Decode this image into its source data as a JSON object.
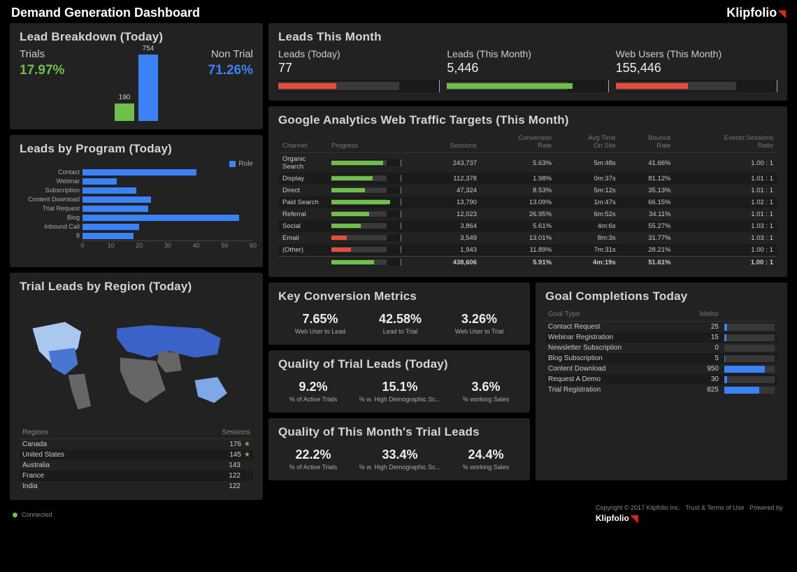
{
  "page": {
    "title": "Demand Generation Dashboard",
    "brand": "Klipfolio"
  },
  "lead_breakdown": {
    "title": "Lead Breakdown (Today)",
    "trials_label": "Trials",
    "trials_pct": "17.97%",
    "nontrial_label": "Non Trial",
    "nontrial_pct": "71.26%",
    "bar_trials": "190",
    "bar_nontrials": "754"
  },
  "leads_by_program": {
    "title": "Leads by Program (Today)",
    "legend": "Role",
    "axis_ticks": [
      "0",
      "10",
      "20",
      "30",
      "40",
      "50",
      "60"
    ]
  },
  "chart_data": [
    {
      "panel": "lead_breakdown",
      "type": "bar",
      "categories": [
        "Trials",
        "Non Trial"
      ],
      "values": [
        190,
        754
      ]
    },
    {
      "panel": "leads_by_program",
      "type": "bar",
      "orientation": "horizontal",
      "xlabel": "",
      "xlim": [
        0,
        60
      ],
      "series_name": "Role",
      "categories": [
        "Contact",
        "Webinar",
        "Subscription",
        "Content Download",
        "Trial Request",
        "Blog",
        "Inbound Call",
        "8"
      ],
      "values": [
        40,
        12,
        19,
        24,
        23,
        55,
        20,
        18
      ]
    },
    {
      "panel": "goal_completions",
      "type": "bar",
      "orientation": "horizontal",
      "categories": [
        "Contact Request",
        "Webinar Registration",
        "Newsletter Subscription",
        "Blog Subscription",
        "Content Download",
        "Request A Demo",
        "Trial Registration"
      ],
      "values": [
        25,
        15,
        0,
        5,
        950,
        30,
        825
      ]
    }
  ],
  "trial_leads_region": {
    "title": "Trial Leads by Region (Today)",
    "headers": {
      "region": "Regions",
      "sessions": "Sessions"
    },
    "rows": [
      {
        "region": "Canada",
        "sessions": "176",
        "star": true
      },
      {
        "region": "United States",
        "sessions": "145",
        "star": true
      },
      {
        "region": "Australia",
        "sessions": "143",
        "star": false
      },
      {
        "region": "France",
        "sessions": "122",
        "star": false
      },
      {
        "region": "India",
        "sessions": "122",
        "star": false
      }
    ]
  },
  "leads_month": {
    "title": "Leads This Month",
    "cards": [
      {
        "title": "Leads (Today)",
        "value": "77",
        "fill_pct": 36,
        "color": "red"
      },
      {
        "title": "Leads (This Month)",
        "value": "5,446",
        "fill_pct": 78,
        "color": "grn"
      },
      {
        "title": "Web Users (This Month)",
        "value": "155,446",
        "fill_pct": 45,
        "color": "red"
      }
    ]
  },
  "ga_targets": {
    "title": "Google Analytics Web Traffic Targets (This Month)",
    "headers": [
      "Channel",
      "Progress",
      "Sessions",
      "Conversion Rate",
      "Avg Time On Site",
      "Bounce Rate",
      "Events:Sessions Ratio"
    ],
    "rows": [
      {
        "channel": "Organic Search",
        "progress": 75,
        "color": "g",
        "sessions": "243,737",
        "conv": "5.63%",
        "time": "5m:48s",
        "bounce": "41.66%",
        "ratio": "1.00 : 1"
      },
      {
        "channel": "Display",
        "progress": 60,
        "color": "g",
        "sessions": "112,378",
        "conv": "1.98%",
        "time": "0m:37s",
        "bounce": "81.12%",
        "ratio": "1.01 : 1"
      },
      {
        "channel": "Direct",
        "progress": 48,
        "color": "g",
        "sessions": "47,324",
        "conv": "8.53%",
        "time": "5m:12s",
        "bounce": "35.13%",
        "ratio": "1.01 : 1"
      },
      {
        "channel": "Paid Search",
        "progress": 85,
        "color": "g",
        "sessions": "13,790",
        "conv": "13.09%",
        "time": "1m:47s",
        "bounce": "66.15%",
        "ratio": "1.02 : 1"
      },
      {
        "channel": "Referral",
        "progress": 55,
        "color": "g",
        "sessions": "12,023",
        "conv": "26.95%",
        "time": "6m:52s",
        "bounce": "34.11%",
        "ratio": "1.01 : 1"
      },
      {
        "channel": "Social",
        "progress": 42,
        "color": "g",
        "sessions": "3,864",
        "conv": "5.61%",
        "time": "4m:6s",
        "bounce": "55.27%",
        "ratio": "1.03 : 1"
      },
      {
        "channel": "Email",
        "progress": 22,
        "color": "r",
        "sessions": "3,549",
        "conv": "13.01%",
        "time": "8m:3s",
        "bounce": "31.77%",
        "ratio": "1.03 : 1"
      },
      {
        "channel": "(Other)",
        "progress": 28,
        "color": "r",
        "sessions": "1,943",
        "conv": "11.89%",
        "time": "7m:31s",
        "bounce": "28.21%",
        "ratio": "1.00 : 1"
      }
    ],
    "total": {
      "progress": 62,
      "color": "g",
      "sessions": "438,606",
      "conv": "5.91%",
      "time": "4m:19s",
      "bounce": "51.61%",
      "ratio": "1.00 : 1"
    }
  },
  "key_conv": {
    "title": "Key Conversion Metrics",
    "items": [
      {
        "v": "7.65%",
        "l": "Web User to Lead"
      },
      {
        "v": "42.58%",
        "l": "Lead to Trial"
      },
      {
        "v": "3.26%",
        "l": "Web User to Trial"
      }
    ]
  },
  "quality_today": {
    "title": "Quality of Trial Leads (Today)",
    "items": [
      {
        "v": "9.2%",
        "l": "% of Active Trials"
      },
      {
        "v": "15.1%",
        "l": "% w. High Demographic Sc..."
      },
      {
        "v": "3.6%",
        "l": "% working Sales"
      }
    ]
  },
  "quality_month": {
    "title": "Quality of This Month's Trial Leads",
    "items": [
      {
        "v": "22.2%",
        "l": "% of Active Trials"
      },
      {
        "v": "33.4%",
        "l": "% w. High Demographic Sc..."
      },
      {
        "v": "24.4%",
        "l": "% working Sales"
      }
    ]
  },
  "goals": {
    "title": "Goal Completions Today",
    "headers": {
      "type": "Goal Type",
      "metric": "Metric"
    },
    "rows": [
      {
        "type": "Contact Request",
        "metric": "25",
        "pct": 5
      },
      {
        "type": "Webinar Registration",
        "metric": "15",
        "pct": 4
      },
      {
        "type": "Newsletter Subscription",
        "metric": "0",
        "pct": 0
      },
      {
        "type": "Blog Subscription",
        "metric": "5",
        "pct": 2
      },
      {
        "type": "Content Download",
        "metric": "950",
        "pct": 80
      },
      {
        "type": "Request A Demo",
        "metric": "30",
        "pct": 6
      },
      {
        "type": "Trial Registration",
        "metric": "825",
        "pct": 70
      }
    ]
  },
  "footer": {
    "connected": "Connected",
    "copyright": "Copyright © 2017",
    "company": "Klipfolio Inc.",
    "terms": "Trust & Terms of Use",
    "powered": "Powered by"
  }
}
